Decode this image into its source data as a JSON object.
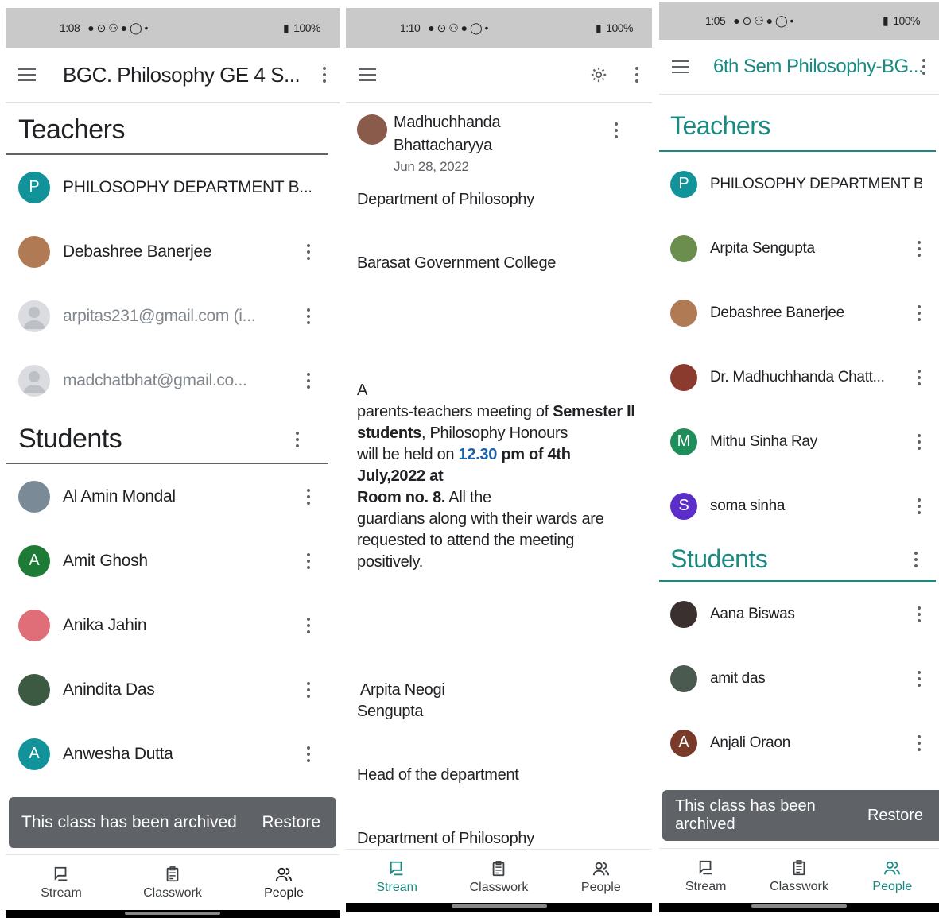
{
  "phone1": {
    "status": {
      "time": "1:08",
      "icons": "● ⊙ ⚇ ● ◯ •",
      "battery": "100%"
    },
    "title": "BGC. Philosophy GE 4 S...",
    "teachers_heading": "Teachers",
    "teachers": [
      {
        "name": "PHILOSOPHY DEPARTMENT B...",
        "initial": "P",
        "color": "#12939a",
        "muted": false
      },
      {
        "name": "Debashree Banerjee",
        "initial": "",
        "color": "#b07a55",
        "muted": false
      },
      {
        "name": "arpitas231@gmail.com (i...",
        "initial": "",
        "color": "#dadce0",
        "muted": true
      },
      {
        "name": "madchatbhat@gmail.co...",
        "initial": "",
        "color": "#dadce0",
        "muted": true
      }
    ],
    "students_heading": "Students",
    "students": [
      {
        "name": "Al Amin Mondal",
        "initial": "",
        "color": "#7a8a96"
      },
      {
        "name": "Amit Ghosh",
        "initial": "A",
        "color": "#1e7b35"
      },
      {
        "name": "Anika Jahin",
        "initial": "",
        "color": "#e06e78"
      },
      {
        "name": "Anindita Das",
        "initial": "",
        "color": "#3c5a42"
      },
      {
        "name": "Anwesha Dutta",
        "initial": "A",
        "color": "#12939a"
      }
    ],
    "snackbar": {
      "message": "This class has been archived",
      "action": "Restore"
    },
    "nav": [
      {
        "label": "Stream"
      },
      {
        "label": "Classwork"
      },
      {
        "label": "People"
      }
    ]
  },
  "phone2": {
    "status": {
      "time": "1:10",
      "icons": "● ⊙ ⚇ ● ◯ •",
      "battery": "100%"
    },
    "author": {
      "line1": "Madhuchhanda",
      "line2": "Bhattacharyya",
      "date": "Jun 28, 2022"
    },
    "body": {
      "l1": "Department of Philosophy",
      "l2": "Barasat Government College",
      "l3": "A",
      "l4a": "parents-teachers meeting of ",
      "l4b": "Semester II",
      "l5a": "students",
      "l5b": ", Philosophy Honours",
      "l6a": "will be held on ",
      "l6b": "12.30",
      "l6c": " pm of 4th July,2022 at",
      "l7a": "Room no. 8.",
      "l7b": " All the",
      "l8": "guardians along with their wards are",
      "l9": "requested to attend the meeting",
      "l10": "positively.",
      "s1": "Arpita Neogi",
      "s2": "Sengupta",
      "s3": "Head of the department",
      "s4": "Department of Philosophy"
    },
    "nav": [
      {
        "label": "Stream"
      },
      {
        "label": "Classwork"
      },
      {
        "label": "People"
      }
    ]
  },
  "phone3": {
    "status": {
      "time": "1:05",
      "icons": "● ⊙ ⚇ ● ◯ •",
      "battery": "100%"
    },
    "title": "6th Sem Philosophy-BG...",
    "teachers_heading": "Teachers",
    "teachers": [
      {
        "name": "PHILOSOPHY DEPARTMENT B...",
        "initial": "P",
        "color": "#12939a"
      },
      {
        "name": "Arpita Sengupta",
        "initial": "",
        "color": "#6b8e4e"
      },
      {
        "name": "Debashree Banerjee",
        "initial": "",
        "color": "#b07a55"
      },
      {
        "name": "Dr. Madhuchhanda Chatt...",
        "initial": "",
        "color": "#8a3b2e"
      },
      {
        "name": "Mithu Sinha Ray",
        "initial": "M",
        "color": "#1e8e5a"
      },
      {
        "name": "soma sinha",
        "initial": "S",
        "color": "#5b2dc9"
      }
    ],
    "students_heading": "Students",
    "students": [
      {
        "name": "Aana Biswas",
        "initial": "",
        "color": "#3a3030"
      },
      {
        "name": "amit das",
        "initial": "",
        "color": "#4a5a50"
      },
      {
        "name": "Anjali Oraon",
        "initial": "A",
        "color": "#7a3a2a"
      }
    ],
    "snackbar": {
      "message": "This class has been archived",
      "action": "Restore"
    },
    "nav": [
      {
        "label": "Stream"
      },
      {
        "label": "Classwork"
      },
      {
        "label": "People"
      }
    ]
  }
}
